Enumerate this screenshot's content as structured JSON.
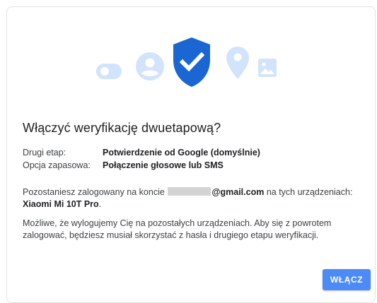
{
  "dialog": {
    "title": "Włączyć weryfikację dwuetapową?",
    "rows": [
      {
        "label": "Drugi etap:",
        "value": "Potwierdzenie od Google (domyślnie)"
      },
      {
        "label": "Opcja zapasowa:",
        "value": "Połączenie głosowe lub SMS"
      }
    ],
    "info": {
      "prefix": "Pozostaniesz zalogowany na koncie",
      "email_domain": "@gmail.com",
      "middle": "na tych urządzeniach:",
      "device": "Xiaomi Mi 10T Pro",
      "suffix": "."
    },
    "note": "Możliwe, że wylogujemy Cię na pozostałych urządzeniach. Aby się z powrotem zalogować, będziesz musiał skorzystać z hasła i drugiego etapu weryfikacji.",
    "enable_button": "WŁĄCZ"
  },
  "icons": [
    "toggle-icon",
    "account-icon",
    "shield-check-icon",
    "location-pin-icon",
    "image-icon"
  ],
  "colors": {
    "accent": "#4c8bf5",
    "shield": "#1a66d2",
    "light_icon": "#d2e3fc"
  }
}
